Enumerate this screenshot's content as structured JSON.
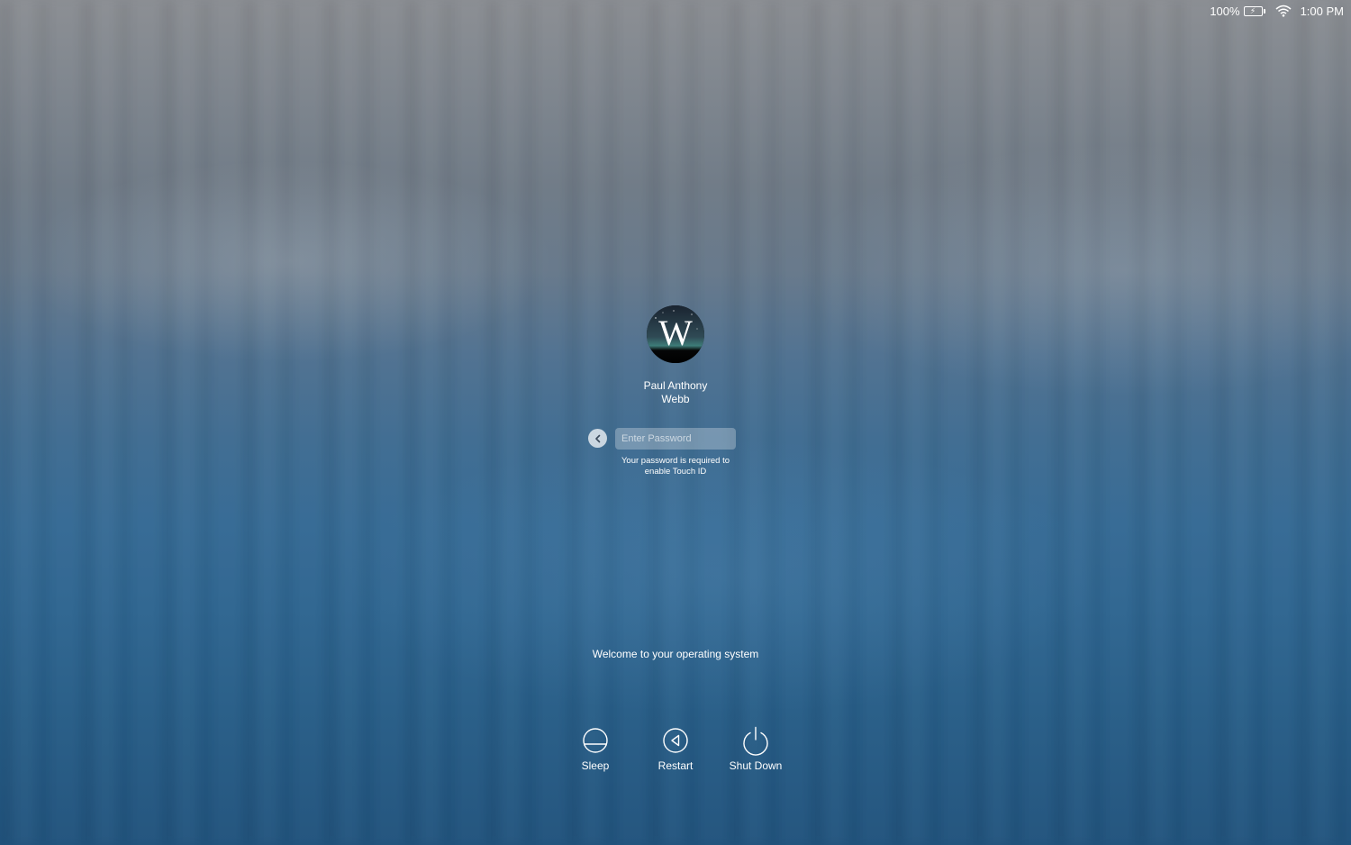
{
  "menubar": {
    "battery_percent": "100%",
    "battery_icon": "battery-charging-icon",
    "wifi_icon": "wifi-icon",
    "time": "1:00 PM"
  },
  "login": {
    "avatar_letter": "W",
    "user_name_line1": "Paul Anthony",
    "user_name_line2": "Webb",
    "password_placeholder": "Enter Password",
    "password_value": "",
    "hint_line1": "Your password is required to",
    "hint_line2": "enable Touch ID"
  },
  "welcome_text": "Welcome to your operating system",
  "power_options": [
    {
      "label": "Sleep",
      "icon": "sleep-icon"
    },
    {
      "label": "Restart",
      "icon": "restart-icon"
    },
    {
      "label": "Shut Down",
      "icon": "shutdown-icon"
    }
  ]
}
